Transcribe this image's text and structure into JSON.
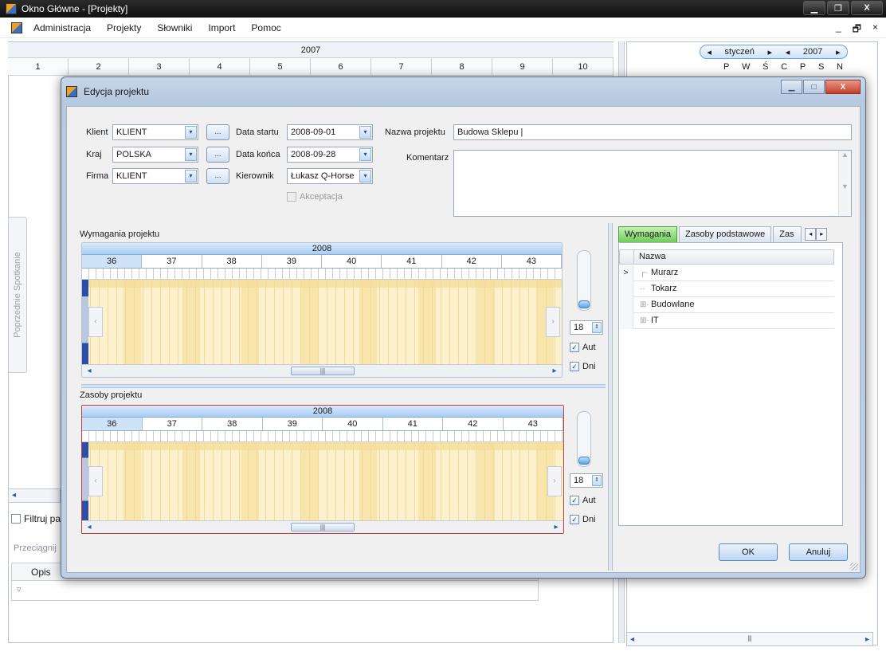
{
  "window": {
    "title": "Okno Główne - [Projekty]",
    "controls": {
      "minimize": "▁",
      "restore": "❐",
      "close": "X"
    }
  },
  "menu": {
    "items": [
      "Administracja",
      "Projekty",
      "Słowniki",
      "Import",
      "Pomoc"
    ],
    "mdi": {
      "minimize": "_",
      "restore": "🗗",
      "close": "×"
    }
  },
  "background": {
    "timeline_year": "2007",
    "weeks": [
      "1",
      "2",
      "3",
      "4",
      "5",
      "6",
      "7",
      "8",
      "9",
      "10"
    ],
    "calendar": {
      "month": "styczeń",
      "year": "2007",
      "days": [
        "P",
        "W",
        "Ś",
        "C",
        "P",
        "S",
        "N"
      ]
    },
    "side_tab": "Poprzednie Spotkanie",
    "filter_label": "Filtruj pa",
    "drag_hint": "Przeciągnij",
    "grid_header": "Opis"
  },
  "dialog": {
    "title": "Edycja projektu",
    "fields": {
      "klient_label": "Klient",
      "klient_value": "KLIENT",
      "kraj_label": "Kraj",
      "kraj_value": "POLSKA",
      "firma_label": "Firma",
      "firma_value": "KLIENT",
      "ellipsis": "...",
      "data_startu_label": "Data startu",
      "data_startu_value": "2008-09-01",
      "data_konca_label": "Data końca",
      "data_konca_value": "2008-09-28",
      "kierownik_label": "Kierownik",
      "kierownik_value": "Łukasz Q-Horse",
      "akceptacja_label": "Akceptacja",
      "nazwa_label": "Nazwa projektu",
      "nazwa_value": "Budowa Sklepu",
      "komentarz_label": "Komentarz"
    },
    "wymagania": {
      "title": "Wymagania projektu",
      "year": "2008",
      "weeks": [
        "36",
        "37",
        "38",
        "39",
        "40",
        "41",
        "42",
        "43"
      ],
      "zoom": "18",
      "aut_label": "Aut",
      "dni_label": "Dni"
    },
    "zasoby": {
      "title": "Zasoby projektu",
      "year": "2008",
      "weeks": [
        "36",
        "37",
        "38",
        "39",
        "40",
        "41",
        "42",
        "43"
      ],
      "zoom": "18",
      "aut_label": "Aut",
      "dni_label": "Dni"
    },
    "tabs": [
      "Wymagania",
      "Zasoby podstawowe",
      "Zas"
    ],
    "tree": {
      "header": "Nazwa",
      "rows": [
        "Murarz",
        "Tokarz",
        "Budowlane",
        "IT"
      ]
    },
    "ok_label": "OK",
    "cancel_label": "Anuluj"
  },
  "colors": {
    "active_tab": "#6ccf56",
    "timeline_header": "#a9cdf2",
    "timeline_body": "#fcf1cc",
    "dialog_frame": "#bfd0e4"
  }
}
